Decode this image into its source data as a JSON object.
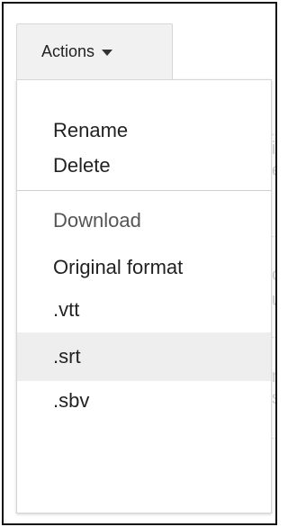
{
  "actions_button": {
    "label": "Actions",
    "icon": "caret-down-icon"
  },
  "menu": {
    "group1": [
      {
        "label": "Rename"
      },
      {
        "label": "Delete"
      }
    ],
    "download_header": "Download",
    "group2": [
      {
        "label": "Original format"
      },
      {
        "label": ".vtt"
      },
      {
        "label": ".srt",
        "highlighted": true
      },
      {
        "label": ".sbv"
      }
    ]
  },
  "colors": {
    "highlight_bg": "#eeeeee",
    "button_bg": "#f1f1f1",
    "border": "#d6d6d6"
  }
}
